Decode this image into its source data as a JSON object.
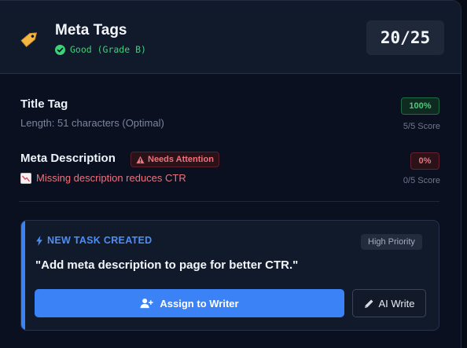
{
  "header": {
    "title": "Meta Tags",
    "grade": "Good (Grade B)",
    "score": "20/25",
    "icon": "tag-icon"
  },
  "title_tag": {
    "label": "Title Tag",
    "detail": "Length: 51 characters (Optimal)",
    "percent": "100%",
    "score_caption": "5/5 Score"
  },
  "meta_description": {
    "label": "Meta Description",
    "badge": "Needs Attention",
    "issue": "Missing description reduces CTR",
    "percent": "0%",
    "score_caption": "0/5 Score"
  },
  "task": {
    "heading": "NEW TASK CREATED",
    "priority": "High Priority",
    "text": "\"Add meta description to page for better CTR.\"",
    "assign_label": "Assign to Writer",
    "ai_label": "AI Write"
  },
  "colors": {
    "accent": "#3b82f6",
    "good": "#3fd07a",
    "bad": "#f0727d",
    "background": "#0a1020"
  }
}
